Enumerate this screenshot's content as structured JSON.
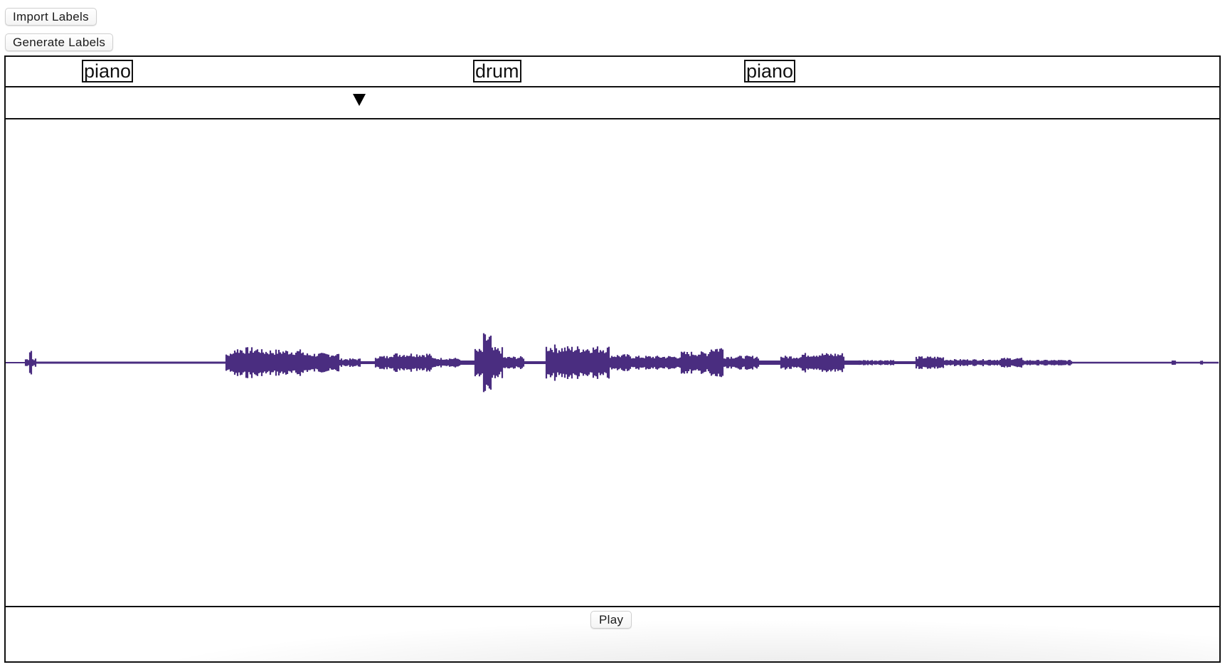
{
  "toolbar": {
    "import_label": "Import Labels",
    "generate_label": "Generate Labels"
  },
  "labels": [
    {
      "text": "piano"
    },
    {
      "text": "drum"
    },
    {
      "text": "piano"
    }
  ],
  "playback": {
    "play_label": "Play"
  },
  "colors": {
    "waveform": "#4a2d80",
    "border": "#111111"
  },
  "icons": {
    "playhead": "down-triangle-marker"
  }
}
